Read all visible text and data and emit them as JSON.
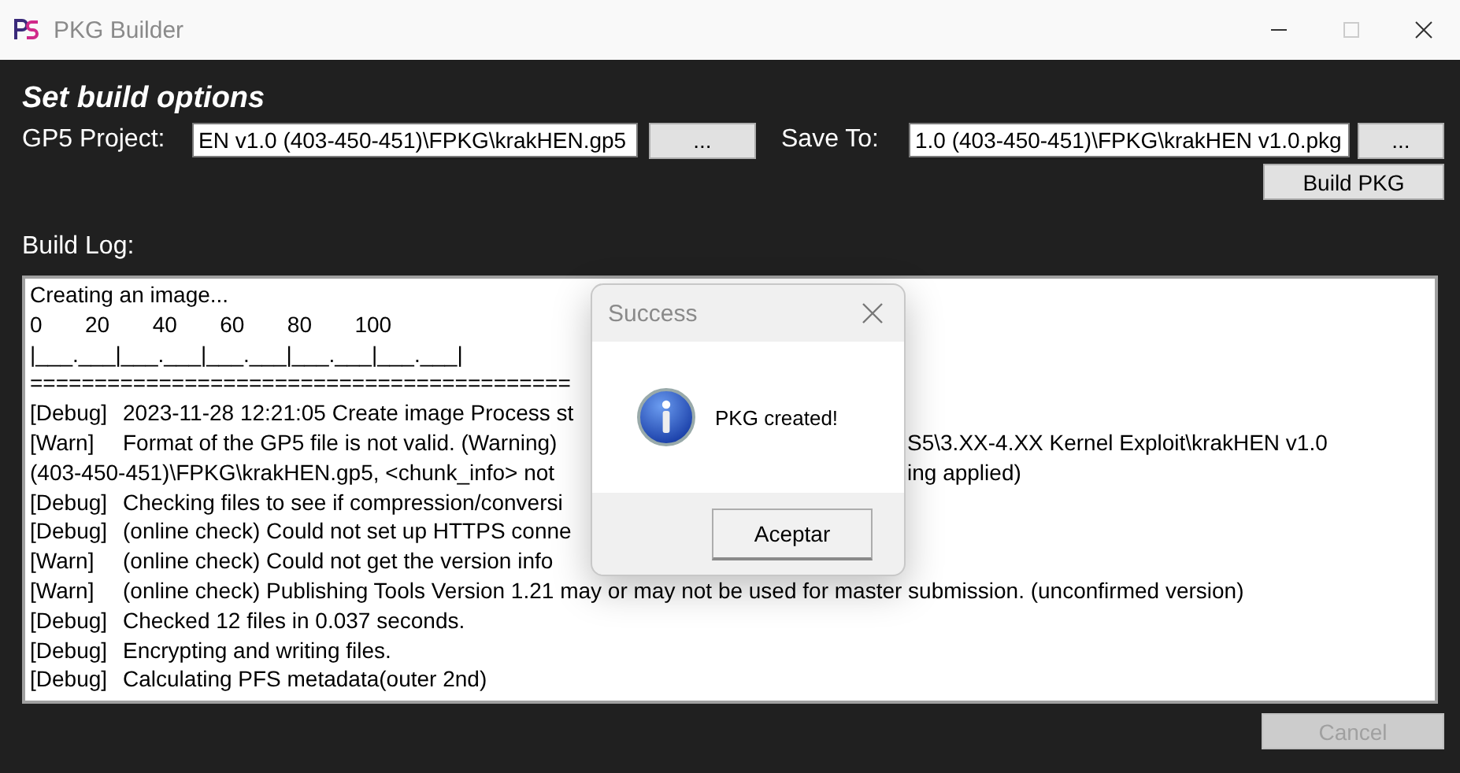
{
  "window": {
    "title": "PKG Builder"
  },
  "heading": "Set build options",
  "project": {
    "label": "GP5 Project:",
    "value": "EN v1.0 (403-450-451)\\FPKG\\krakHEN.gp5",
    "browse": "..."
  },
  "save_to": {
    "label": "Save To:",
    "value": "1.0 (403-450-451)\\FPKG\\krakHEN v1.0.pkg",
    "browse": "..."
  },
  "build_button": "Build PKG",
  "log": {
    "label": "Build Log:",
    "lines": [
      {
        "text": "Creating an image..."
      },
      {
        "text": "0       20       40       60       80       100"
      },
      {
        "text": "|___.___|___.___|___.___|___.___|___.___|"
      },
      {
        "text": "=========================================="
      },
      {
        "tag": "[Debug]",
        "text": "2023-11-28 12:21:05 Create image Process st"
      },
      {
        "tag": "[Warn]",
        "text": "Format of the GP5 file is not valid. (Warning)",
        "right": "S5\\3.XX-4.XX Kernel Exploit\\krakHEN v1.0"
      },
      {
        "text": "(403-450-451)\\FPKG\\krakHEN.gp5, <chunk_info> not",
        "right": "ing applied)"
      },
      {
        "tag": "[Debug]",
        "text": "Checking files to see if compression/conversi"
      },
      {
        "tag": "[Debug]",
        "text": "(online check) Could not set up HTTPS conne"
      },
      {
        "tag": "[Warn]",
        "text": "(online check) Could not get the version info"
      },
      {
        "tag": "[Warn]",
        "text": "(online check) Publishing Tools Version 1.21 may or may not be used for master submission. (unconfirmed version)"
      },
      {
        "tag": "[Debug]",
        "text": "Checked 12 files in 0.037 seconds."
      },
      {
        "tag": "[Debug]",
        "text": "Encrypting and writing files."
      },
      {
        "tag": "[Debug]",
        "text": "Calculating PFS metadata(outer 2nd)"
      }
    ]
  },
  "cancel": {
    "label": "Cancel",
    "disabled": true
  },
  "dialog": {
    "title": "Success",
    "message": "PKG created!",
    "button": "Aceptar"
  }
}
